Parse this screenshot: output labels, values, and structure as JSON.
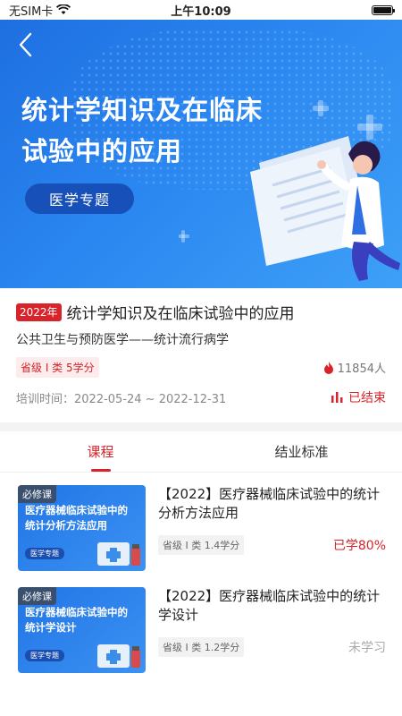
{
  "status_bar": {
    "carrier": "无SIM卡",
    "time": "上午10:09"
  },
  "banner": {
    "title_line1": "统计学知识及在临床",
    "title_line2": "试验中的应用",
    "tag": "医学专题"
  },
  "course": {
    "year_badge": "2022年",
    "title": "统计学知识及在临床试验中的应用",
    "subtitle": "公共卫生与预防医学——统计流行病学",
    "credit": "省级 I 类 5学分",
    "learners": "11854人",
    "date": "培训时间：2022-05-24 ~ 2022-12-31",
    "status": "已结束"
  },
  "tabs": [
    {
      "label": "课程"
    },
    {
      "label": "结业标准"
    }
  ],
  "lessons": [
    {
      "thumb_tag": "必修课",
      "thumb_title_1": "医疗器械临床试验中的",
      "thumb_title_2": "统计分析方法应用",
      "thumb_pill": "医学专题",
      "title": "【2022】医疗器械临床试验中的统计分析方法应用",
      "credit": "省级 I 类 1.4学分",
      "progress": "已学80%"
    },
    {
      "thumb_tag": "必修课",
      "thumb_title_1": "医疗器械临床试验中的",
      "thumb_title_2": "统计学设计",
      "thumb_pill": "医学专题",
      "title": "【2022】医疗器械临床试验中的统计学设计",
      "credit": "省级 I 类 1.2学分",
      "progress": "未学习"
    }
  ]
}
